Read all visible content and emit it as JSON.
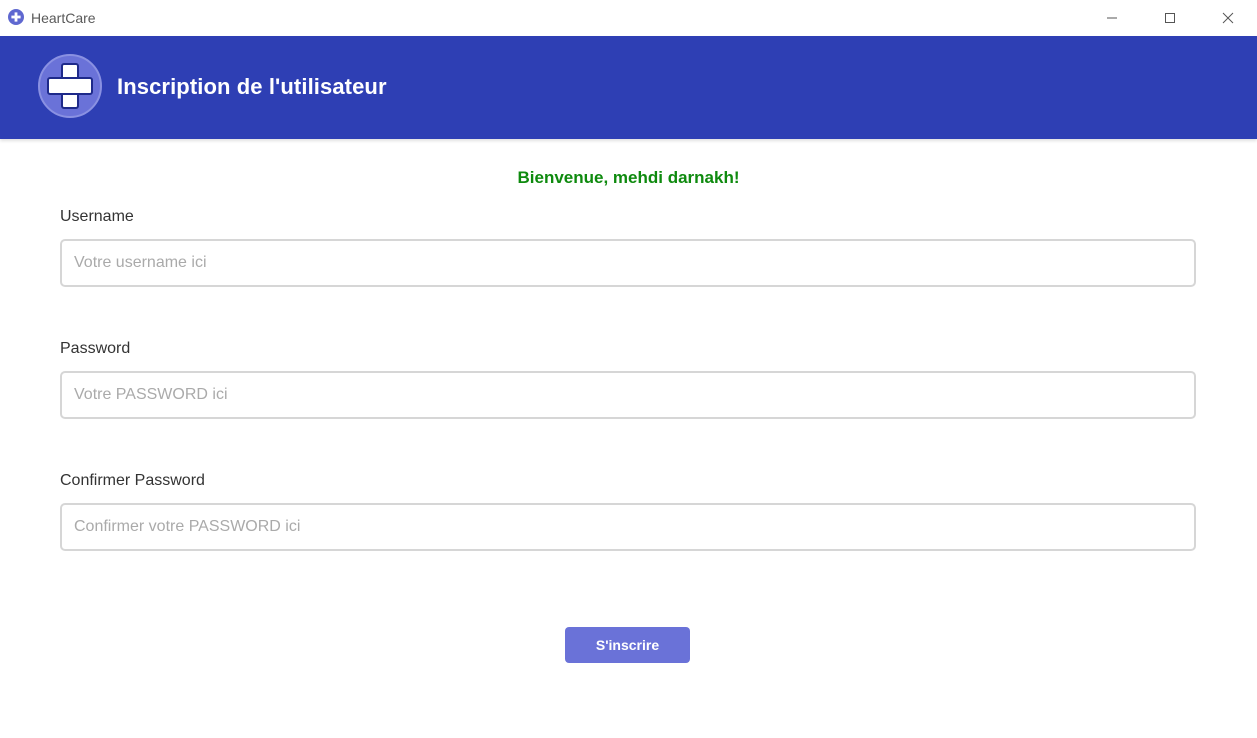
{
  "window": {
    "title": "HeartCare",
    "app_icon": "plus-circle-icon",
    "controls": [
      "minimize-icon",
      "maximize-icon",
      "close-icon"
    ]
  },
  "header": {
    "title": "Inscription de l'utilisateur",
    "logo": "plus-circle-icon",
    "background_color": "#2e3fb4"
  },
  "form": {
    "welcome": "Bienvenue, mehdi darnakh!",
    "welcome_color": "#0e8a0e",
    "username": {
      "label": "Username",
      "value": "",
      "placeholder": "Votre username ici"
    },
    "password": {
      "label": "Password",
      "value": "",
      "placeholder": "Votre PASSWORD ici"
    },
    "confirm_password": {
      "label": "Confirmer Password",
      "value": "",
      "placeholder": "Confirmer votre PASSWORD ici"
    },
    "submit_label": "S'inscrire",
    "submit_color": "#6a72d8"
  }
}
